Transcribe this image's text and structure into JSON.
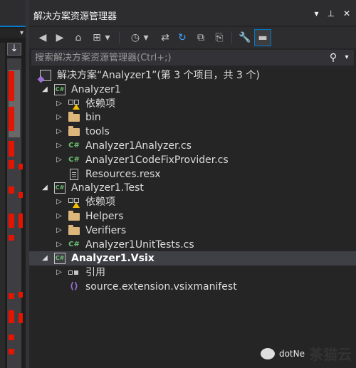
{
  "panel": {
    "title": "解决方案资源管理器",
    "title_buttons": [
      "▾",
      "⊥",
      "✕"
    ]
  },
  "editor": {
    "split_button": "⇣",
    "dropdown_arrow": "▾"
  },
  "toolbar": {
    "buttons": [
      {
        "name": "back-icon",
        "glyph": "◀"
      },
      {
        "name": "forward-icon",
        "glyph": "▶"
      },
      {
        "name": "home-icon",
        "glyph": "⌂"
      },
      {
        "name": "switch-views-icon",
        "glyph": "⊞"
      },
      {
        "name": "switch-views-dropdown",
        "glyph": "▾"
      },
      {
        "name": "pending-changes-icon",
        "glyph": "◷"
      },
      {
        "name": "pending-changes-dropdown",
        "glyph": "▾"
      },
      {
        "name": "sync-icon",
        "glyph": "⇄"
      },
      {
        "name": "refresh-icon",
        "glyph": "↻"
      },
      {
        "name": "collapse-all-icon",
        "glyph": "⧉"
      },
      {
        "name": "show-all-files-icon",
        "glyph": "⎘"
      },
      {
        "name": "properties-icon",
        "glyph": "🔧"
      },
      {
        "name": "preview-icon",
        "glyph": "▬"
      }
    ]
  },
  "search": {
    "placeholder": "搜索解决方案资源管理器(Ctrl+;)",
    "search_glyph": "⚲",
    "dropdown_glyph": "▾"
  },
  "tree": {
    "solution": "解决方案“Analyzer1”(第 3 个项目，共 3 个)",
    "items": [
      {
        "label": "Analyzer1",
        "icon": "cs-project",
        "expanded": true
      },
      {
        "label": "依赖项",
        "icon": "dependencies",
        "expanded": false
      },
      {
        "label": "bin",
        "icon": "folder",
        "expanded": false
      },
      {
        "label": "tools",
        "icon": "folder",
        "expanded": false
      },
      {
        "label": "Analyzer1Analyzer.cs",
        "icon": "cs-file",
        "expanded": false
      },
      {
        "label": "Analyzer1CodeFixProvider.cs",
        "icon": "cs-file",
        "expanded": false
      },
      {
        "label": "Resources.resx",
        "icon": "resx-file",
        "expanded": false
      },
      {
        "label": "Analyzer1.Test",
        "icon": "cs-project",
        "expanded": true
      },
      {
        "label": "依赖项",
        "icon": "dependencies",
        "expanded": false
      },
      {
        "label": "Helpers",
        "icon": "folder",
        "expanded": false
      },
      {
        "label": "Verifiers",
        "icon": "folder",
        "expanded": false
      },
      {
        "label": "Analyzer1UnitTests.cs",
        "icon": "cs-file",
        "expanded": false
      },
      {
        "label": "Analyzer1.Vsix",
        "icon": "cs-project",
        "expanded": true
      },
      {
        "label": "引用",
        "icon": "references",
        "expanded": false
      },
      {
        "label": "source.extension.vsixmanifest",
        "icon": "vsix-manifest",
        "expanded": false
      }
    ],
    "arrow_expanded": "◢",
    "arrow_collapsed": "▷"
  },
  "watermark": {
    "text": "dotNe",
    "big_text": "茶猫云"
  },
  "colors": {
    "accent": "#007acc",
    "marker": "#e51400",
    "folder": "#dcb67a",
    "csharp": "#6cc070",
    "vs_purple": "#9b6fd6"
  }
}
